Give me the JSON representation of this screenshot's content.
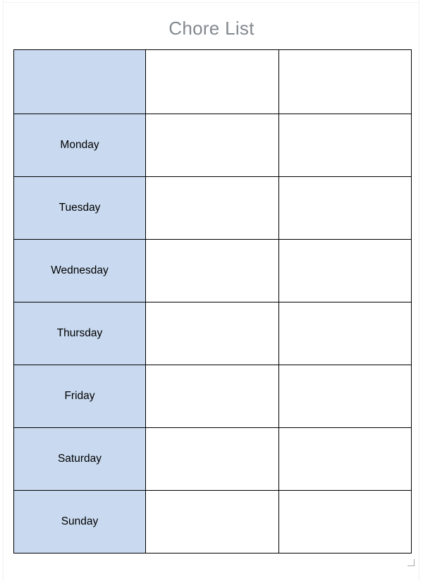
{
  "document": {
    "title": "Chore List"
  },
  "table": {
    "columns": [
      {
        "key": "day",
        "header": ""
      },
      {
        "key": "task1",
        "header": ""
      },
      {
        "key": "task2",
        "header": ""
      }
    ],
    "header_row": {
      "day": "",
      "task1": "",
      "task2": ""
    },
    "rows": [
      {
        "day": "Monday",
        "task1": "",
        "task2": ""
      },
      {
        "day": "Tuesday",
        "task1": "",
        "task2": ""
      },
      {
        "day": "Wednesday",
        "task1": "",
        "task2": ""
      },
      {
        "day": "Thursday",
        "task1": "",
        "task2": ""
      },
      {
        "day": "Friday",
        "task1": "",
        "task2": ""
      },
      {
        "day": "Saturday",
        "task1": "",
        "task2": ""
      },
      {
        "day": "Sunday",
        "task1": "",
        "task2": ""
      }
    ]
  },
  "colors": {
    "day_column_fill": "#c9daf0",
    "cell_fill": "#ffffff",
    "border": "#000000",
    "title_text": "#83898e",
    "cell_text": "#000000"
  },
  "icons": {
    "resize_handle": "table-resize-handle-icon"
  }
}
